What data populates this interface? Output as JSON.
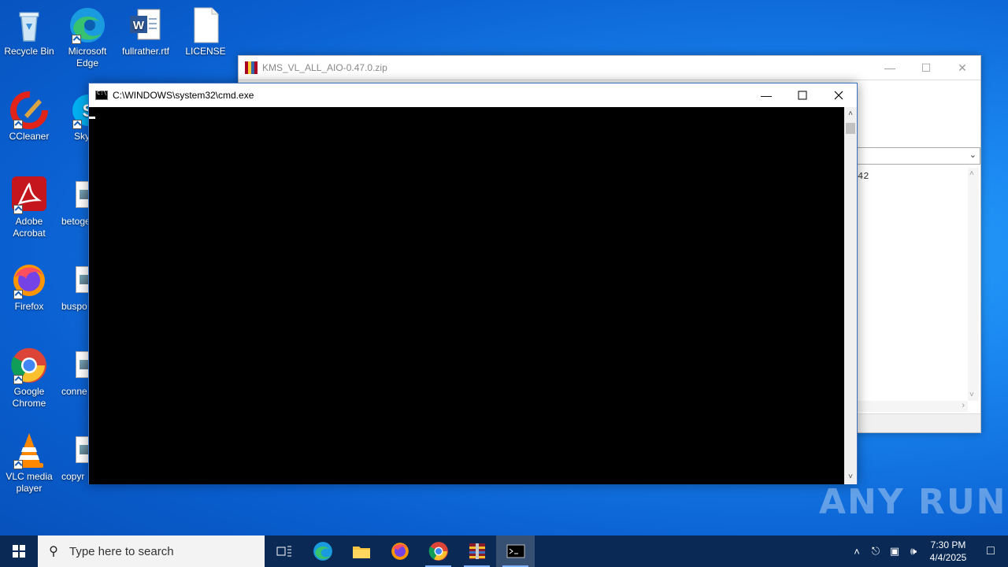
{
  "desktop": {
    "icons": [
      {
        "label": "Recycle Bin"
      },
      {
        "label": "Microsoft Edge"
      },
      {
        "label": "fullrather.rtf"
      },
      {
        "label": "LICENSE"
      },
      {
        "label": "CCleaner"
      },
      {
        "label": "Sky"
      },
      {
        "label": "Adobe Acrobat"
      },
      {
        "label": "betoge"
      },
      {
        "label": "Firefox"
      },
      {
        "label": "buspo"
      },
      {
        "label": "Google Chrome"
      },
      {
        "label": "conne"
      },
      {
        "label": "VLC media player"
      },
      {
        "label": "copyr"
      }
    ]
  },
  "winrar_window": {
    "title": "KMS_VL_ALL_AIO-0.47.0.zip",
    "partial_text": "42"
  },
  "cmd_window": {
    "title": "C:\\WINDOWS\\system32\\cmd.exe"
  },
  "taskbar": {
    "search_placeholder": "Type here to search",
    "apps": [
      "task-view",
      "edge",
      "file-explorer",
      "firefox",
      "chrome",
      "winrar",
      "cmd"
    ],
    "active_app": "cmd"
  },
  "clock": {
    "time": "7:30 PM",
    "date": "4/4/2025"
  },
  "watermark": "ANY RUN"
}
